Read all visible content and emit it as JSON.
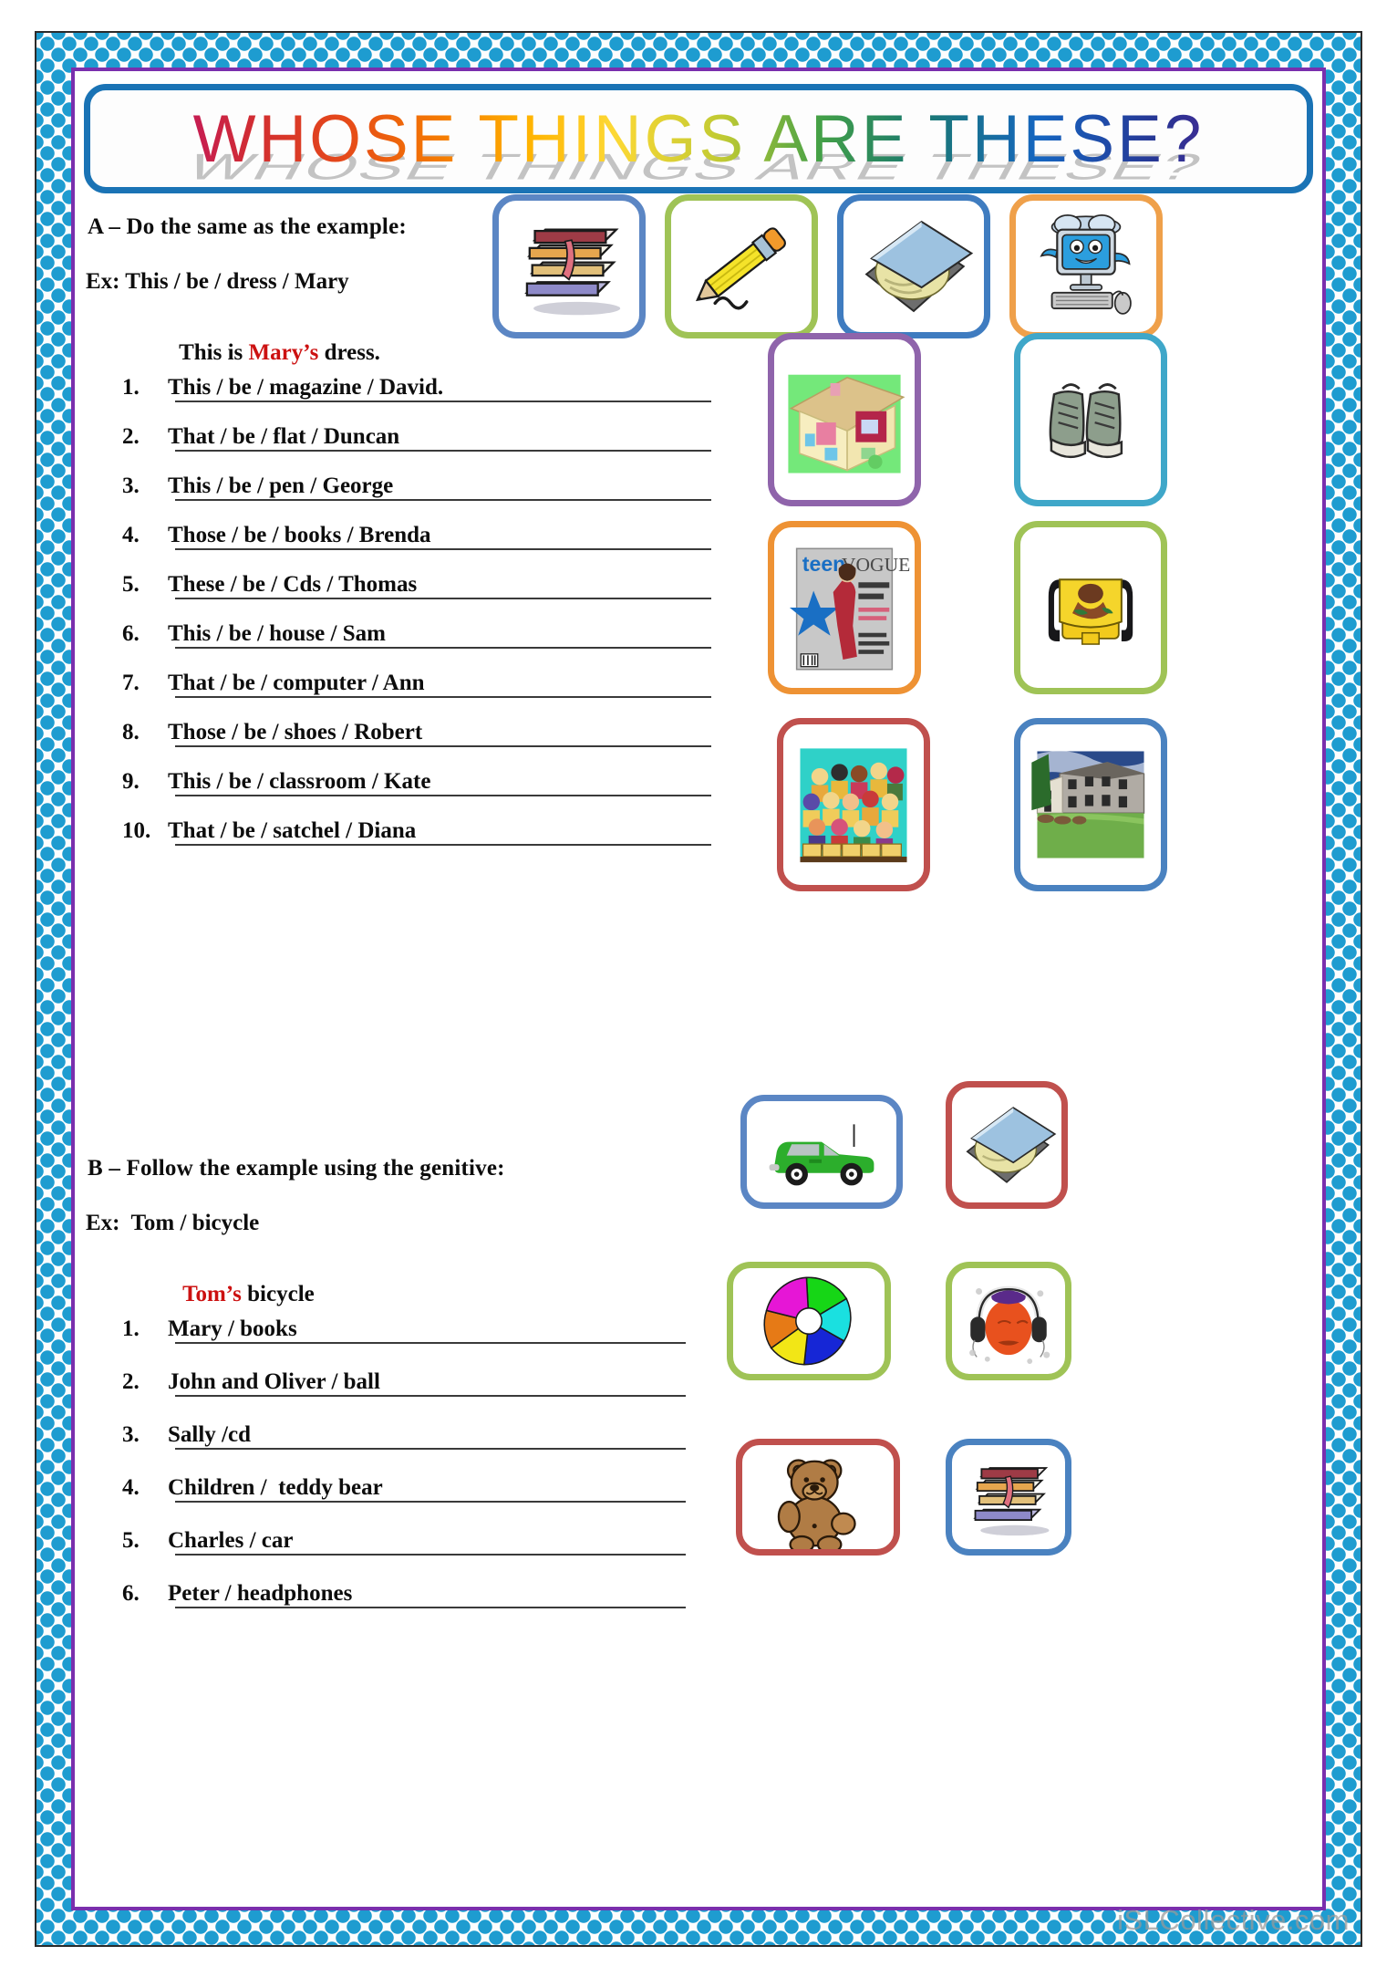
{
  "title": "WHOSE THINGS ARE THESE?",
  "watermark": "iSLCollective.com",
  "colors": {
    "border_pattern": "#1e9cd0",
    "inner_frame": "#7a2fad",
    "title_box_border": "#1a73b5",
    "highlight_red": "#cc1111",
    "text": "#0d0d0d",
    "answer_line": "#3a3a3a"
  },
  "section_a": {
    "heading": "A – Do the same as the example:",
    "example_prompt": "Ex: This / be / dress / Mary",
    "example_answer_prefix": "This is ",
    "example_answer_highlight": "Mary’s",
    "example_answer_suffix": " dress.",
    "items": [
      {
        "num": "1.",
        "text": "This / be / magazine / David."
      },
      {
        "num": "2.",
        "text": "That / be / flat / Duncan"
      },
      {
        "num": "3.",
        "text": "This / be / pen / George"
      },
      {
        "num": "4.",
        "text": "Those / be / books / Brenda"
      },
      {
        "num": "5.",
        "text": "These / be / Cds / Thomas"
      },
      {
        "num": "6.",
        "text": "This / be / house / Sam"
      },
      {
        "num": "7.",
        "text": "That / be / computer / Ann"
      },
      {
        "num": "8.",
        "text": "Those / be / shoes / Robert"
      },
      {
        "num": "9.",
        "text": "This / be / classroom / Kate"
      },
      {
        "num": "10.",
        "text": "That / be / satchel / Diana"
      }
    ]
  },
  "section_b": {
    "heading": "B – Follow the example using the genitive:",
    "example_prompt": "Ex:  Tom / bicycle",
    "example_answer_highlight": "Tom’s",
    "example_answer_suffix": " bicycle",
    "items": [
      {
        "num": "1.",
        "text": "Mary / books"
      },
      {
        "num": "2.",
        "text": "John and Oliver / ball"
      },
      {
        "num": "3.",
        "text": "Sally /cd"
      },
      {
        "num": "4.",
        "text": "Children /  teddy bear"
      },
      {
        "num": "5.",
        "text": "Charles / car"
      },
      {
        "num": "6.",
        "text": "Peter / headphones"
      }
    ]
  },
  "pictures": [
    {
      "id": "books-top",
      "label": "stack of books",
      "frame": "#5b86c4"
    },
    {
      "id": "pencil",
      "label": "yellow pencil",
      "frame": "#9fc356"
    },
    {
      "id": "cd-drive-top",
      "label": "cd in open case",
      "frame": "#3f7cc0"
    },
    {
      "id": "computer",
      "label": "cartoon computer",
      "frame": "#efa04a"
    },
    {
      "id": "dollhouse",
      "label": "toy house",
      "frame": "#8f64ab"
    },
    {
      "id": "sneakers",
      "label": "pair of sneakers",
      "frame": "#3fa7c9"
    },
    {
      "id": "magazine",
      "label": "teen vogue magazine",
      "frame": "#ee9234"
    },
    {
      "id": "satchel",
      "label": "yellow satchel bag",
      "frame": "#9fc356"
    },
    {
      "id": "classroom",
      "label": "classroom of children",
      "frame": "#c0504d"
    },
    {
      "id": "flats",
      "label": "block of flats",
      "frame": "#4a82c0"
    },
    {
      "id": "car",
      "label": "green car",
      "frame": "#5b86c4"
    },
    {
      "id": "cd-drive-bot",
      "label": "cd in open case",
      "frame": "#c0504d"
    },
    {
      "id": "ball",
      "label": "colourful beach ball",
      "frame": "#9fc356"
    },
    {
      "id": "headphones",
      "label": "face with headphones",
      "frame": "#9fc356"
    },
    {
      "id": "teddy",
      "label": "teddy bear",
      "frame": "#c0504d"
    },
    {
      "id": "books-bottom",
      "label": "stack of books",
      "frame": "#4a82c0"
    }
  ]
}
